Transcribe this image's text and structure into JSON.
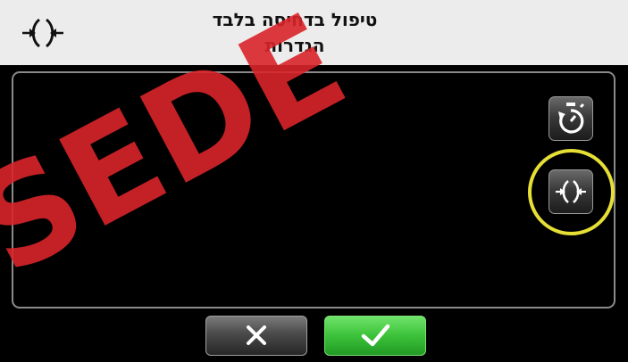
{
  "header": {
    "title": "טיפול בדחיסה בלבד",
    "subtitle": "הגדרות",
    "icon": "compression-only-icon"
  },
  "panel": {
    "buttons": [
      {
        "icon": "metronome-timer-icon"
      },
      {
        "icon": "compression-only-icon",
        "highlighted": true
      }
    ]
  },
  "footer": {
    "cancel_icon": "close-icon",
    "confirm_icon": "checkmark-icon"
  },
  "watermark": {
    "text": "SEDE",
    "color": "#d9252a"
  },
  "colors": {
    "header_bg": "#ececec",
    "highlight_ring": "#e6df36",
    "confirm_green": "#3cc23a"
  }
}
